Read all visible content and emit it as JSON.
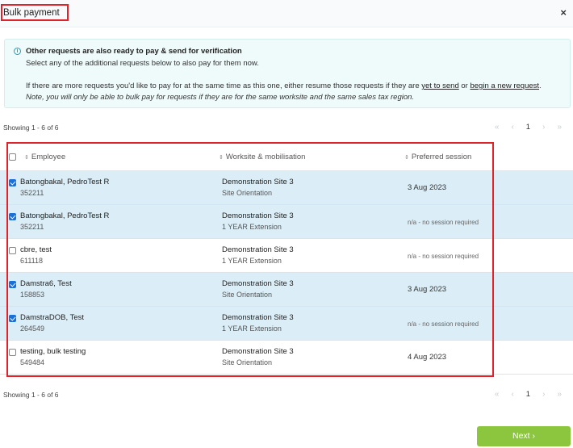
{
  "dialog": {
    "title": "Bulk payment",
    "close_label": "×"
  },
  "info": {
    "icon": "info-icon",
    "heading": "Other requests are also ready to pay & send for verification",
    "subtext": "Select any of the additional requests below to also pay for them now.",
    "more_prefix": "If there are more requests you'd like to pay for at the same time as this one, either resume those requests if they are ",
    "link_yet_to_send": "yet to send",
    "more_or": " or ",
    "link_new_request": "begin a new request",
    "more_suffix": ".",
    "note": "Note, you will only be able to bulk pay for requests if they are for the same worksite and the same sales tax region."
  },
  "pagination": {
    "showing_top": "Showing 1 - 6 of 6",
    "showing_bottom": "Showing 1 - 6 of 6",
    "first": "«",
    "prev": "‹",
    "current": "1",
    "next": "›",
    "last": "»"
  },
  "table": {
    "headers": {
      "employee": "Employee",
      "worksite": "Worksite & mobilisation",
      "session": "Preferred session"
    },
    "rows": [
      {
        "name": "Batongbakal, PedroTest R",
        "id": "352211",
        "site": "Demonstration Site 3",
        "mobilisation": "Site Orientation",
        "session": "3 Aug 2023",
        "checked": true
      },
      {
        "name": "Batongbakal, PedroTest R",
        "id": "352211",
        "site": "Demonstration Site 3",
        "mobilisation": "1 YEAR Extension",
        "session": "n/a - no session required",
        "checked": true
      },
      {
        "name": "cbre, test",
        "id": "611118",
        "site": "Demonstration Site 3",
        "mobilisation": "1 YEAR Extension",
        "session": "n/a - no session required",
        "checked": false
      },
      {
        "name": "Damstra6, Test",
        "id": "158853",
        "site": "Demonstration Site 3",
        "mobilisation": "Site Orientation",
        "session": "3 Aug 2023",
        "checked": true
      },
      {
        "name": "DamstraDOB, Test",
        "id": "264549",
        "site": "Demonstration Site 3",
        "mobilisation": "1 YEAR Extension",
        "session": "n/a - no session required",
        "checked": true
      },
      {
        "name": "testing, bulk testing",
        "id": "549484",
        "site": "Demonstration Site 3",
        "mobilisation": "Site Orientation",
        "session": "4 Aug 2023",
        "checked": false
      }
    ]
  },
  "footer": {
    "next_label": "Next  ›"
  },
  "colors": {
    "accent_green": "#8cc63f",
    "selected_row": "#dbeef8",
    "highlight_red": "#e0222a",
    "info_bg": "#effafa"
  }
}
